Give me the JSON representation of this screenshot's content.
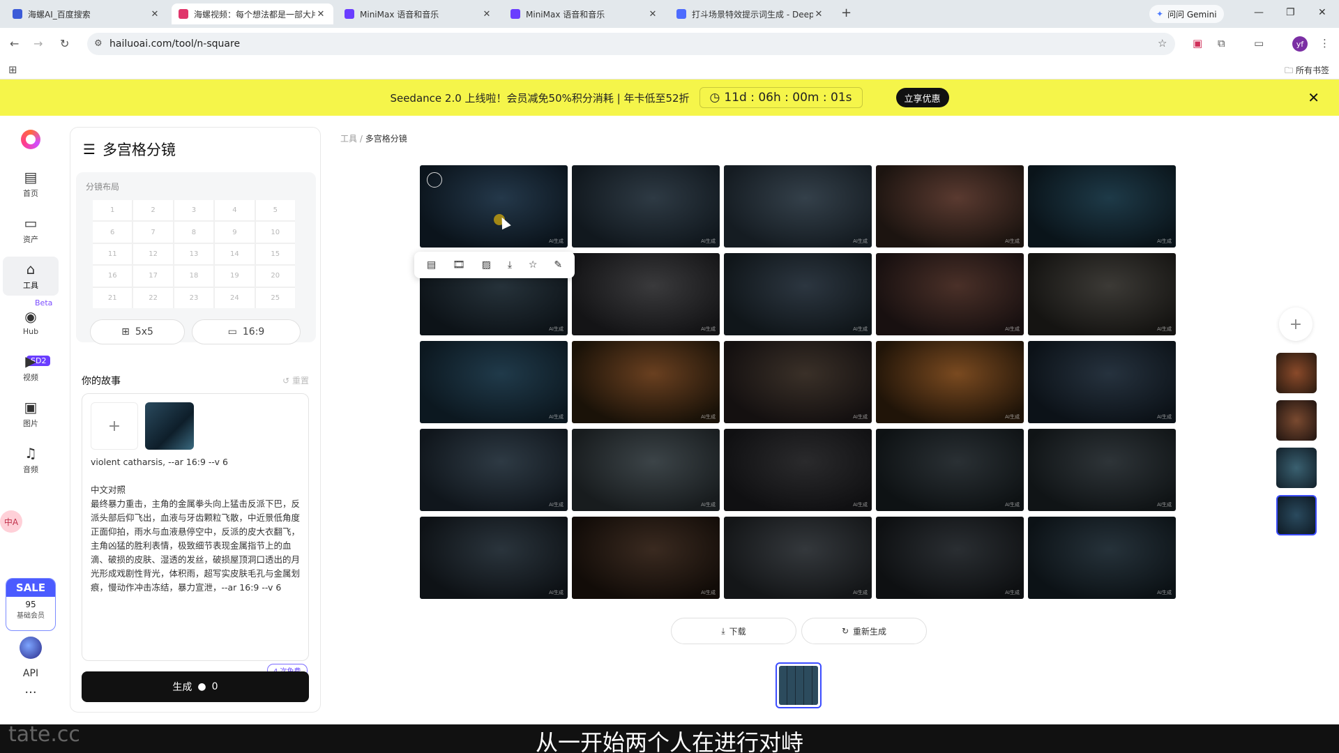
{
  "browser": {
    "tabs": [
      {
        "title": "海螺AI_百度搜索",
        "color": "#3c5bd8"
      },
      {
        "title": "海螺视频：每个想法都是一部大片",
        "color": "#e0356b"
      },
      {
        "title": "MiniMax 语音和音乐",
        "color": "#6a3dff"
      },
      {
        "title": "MiniMax 语音和音乐",
        "color": "#6a3dff"
      },
      {
        "title": "打斗场景特效提示词生成 - DeepSeek",
        "color": "#4d6bfe"
      }
    ],
    "new_tab": "+",
    "gemini_label": "问问 Gemini",
    "url": "hailuoai.com/tool/n-square",
    "all_bookmarks": "所有书签",
    "profile_initial": "yf"
  },
  "promo": {
    "text": "Seedance 2.0 上线啦！会员减免50%积分消耗 | 年卡低至52折",
    "timer": "11d : 06h : 00m : 01s",
    "button": "立享优惠"
  },
  "rail": {
    "items": [
      {
        "label": "首页",
        "icon": "▤"
      },
      {
        "label": "资产",
        "icon": "▭"
      },
      {
        "label": "工具",
        "icon": "⌂"
      },
      {
        "label": "Hub",
        "icon": "◉"
      },
      {
        "label": "视频",
        "icon": "▶"
      },
      {
        "label": "图片",
        "icon": "▣"
      },
      {
        "label": "音频",
        "icon": "♫"
      }
    ],
    "beta": "Beta",
    "sd2": "SD2",
    "translate": "中A",
    "sale_title": "SALE",
    "sale_num": "95",
    "sale_sub": "基础会员",
    "api": "API",
    "more": "···"
  },
  "panel": {
    "title": "多宫格分镜",
    "layout_label": "分镜布局",
    "grid_numbers": [
      "1",
      "2",
      "3",
      "4",
      "5",
      "6",
      "7",
      "8",
      "9",
      "10",
      "11",
      "12",
      "13",
      "14",
      "15",
      "16",
      "17",
      "18",
      "19",
      "20",
      "21",
      "22",
      "23",
      "24",
      "25"
    ],
    "grid_button": "5x5",
    "ratio_button": "16:9",
    "story_label": "你的故事",
    "story_reset": "重置",
    "story_text": "violent catharsis, --ar 16:9 --v 6\n\n中文对照\n最终暴力重击，主角的金属拳头向上猛击反派下巴，反派头部后仰飞出，血液与牙齿颗粒飞散，中近景低角度正面仰拍，雨水与血液悬停空中，反派的皮大衣翻飞，主角凶猛的胜利表情，极致细节表现金属指节上的血滴、破损的皮肤、湿透的发丝，破损屋顶洞口透出的月光形成戏剧性背光，体积雨，超写实皮肤毛孔与金属划痕，慢动作冲击冻结，暴力宣泄，--ar 16:9 --v 6",
    "generate": "生成",
    "generate_cost": "0",
    "free_badge": "4 次免费"
  },
  "breadcrumb": {
    "root": "工具",
    "sep": "/",
    "current": "多宫格分镜"
  },
  "grid_watermark": "AI生成",
  "toolbar_icons": [
    "hd-icon",
    "film-icon",
    "image-edit-icon",
    "download-icon",
    "star-icon",
    "magic-wand-icon"
  ],
  "actions": {
    "download": "下载",
    "regenerate": "重新生成"
  },
  "subtitle": "从一开始两个人在进行对峙",
  "watermark_logo": "tate.cc",
  "cells": [
    [
      "#24384a",
      "#0b141c"
    ],
    [
      "#2e3a44",
      "#11181e"
    ],
    [
      "#34404a",
      "#151c22"
    ],
    [
      "#5a3a30",
      "#1c1410"
    ],
    [
      "#1e3a48",
      "#0a141a"
    ],
    [
      "#26323a",
      "#0d1318"
    ],
    [
      "#3a3a3c",
      "#141416"
    ],
    [
      "#2c3640",
      "#10161a"
    ],
    [
      "#4a3028",
      "#181010"
    ],
    [
      "#3c3a36",
      "#151412"
    ],
    [
      "#203a4a",
      "#0c1820"
    ],
    [
      "#6a4020",
      "#1a1208"
    ],
    [
      "#3a3028",
      "#141010"
    ],
    [
      "#7a4a20",
      "#201408"
    ],
    [
      "#26323e",
      "#0c1218"
    ],
    [
      "#2e3a44",
      "#10161c"
    ],
    [
      "#3c4448",
      "#181c1e"
    ],
    [
      "#2a2a2c",
      "#101012"
    ],
    [
      "#2a3034",
      "#0e1214"
    ],
    [
      "#2e3438",
      "#101416"
    ],
    [
      "#2a343c",
      "#0e1216"
    ],
    [
      "#3a2a20",
      "#120c08"
    ],
    [
      "#34383c",
      "#141618"
    ],
    [
      "#2a2e32",
      "#0e1012"
    ],
    [
      "#26323a",
      "#0c1216"
    ]
  ],
  "right_thumbs": [
    [
      "#8a4a2a",
      "#2a1a10"
    ],
    [
      "#7a4a30",
      "#201410"
    ],
    [
      "#3a6070",
      "#12202a"
    ],
    [
      "#2a4a5e",
      "#0e1a24"
    ]
  ]
}
